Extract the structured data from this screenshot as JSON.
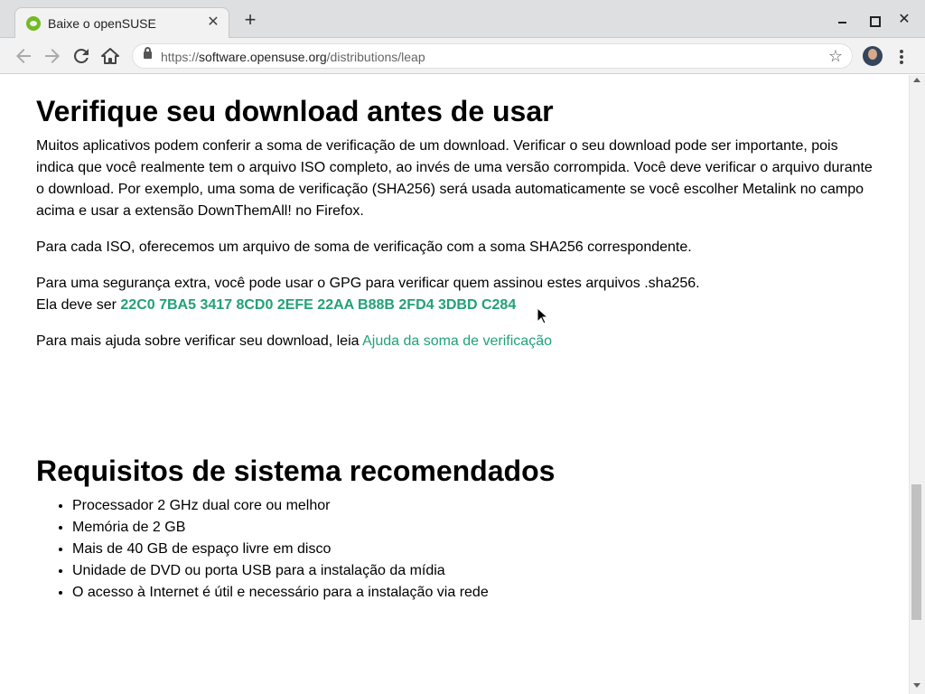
{
  "browser": {
    "tab_title": "Baixe o openSUSE",
    "tab_close": "✕",
    "new_tab": "+",
    "url_scheme": "https://",
    "url_host": "software.opensuse.org",
    "url_path": "/distributions/leap",
    "window_close": "✕"
  },
  "icons": {
    "back": "arrow-left-icon",
    "forward": "arrow-right-icon",
    "reload": "reload-icon",
    "home": "home-icon",
    "lock": "lock-icon",
    "star": "star-icon",
    "menu": "kebab-menu-icon"
  },
  "section_verify": {
    "heading": "Verifique seu download antes de usar",
    "para1": "Muitos aplicativos podem conferir a soma de verificação de um download. Verificar o seu download pode ser importante, pois indica que você realmente tem o arquivo ISO completo, ao invés de uma versão corrompida. Você deve verificar o arquivo durante o download. Por exemplo, uma soma de verificação (SHA256) será usada automaticamente se você escolher Metalink no campo acima e usar a extensão DownThemAll! no Firefox.",
    "para2": "Para cada ISO, oferecemos um arquivo de soma de verificação com a soma SHA256 correspondente.",
    "para3_line1": "Para uma segurança extra, você pode usar o GPG para verificar quem assinou estes arquivos .sha256.",
    "para3_line2_prefix": "Ela deve ser",
    "gpg_fingerprint": "22C0 7BA5 3417 8CD0 2EFE 22AA B88B 2FD4 3DBD C284",
    "para4_prefix": "Para mais ajuda sobre verificar seu download, leia",
    "help_link": "Ajuda da soma de verificação"
  },
  "section_requirements": {
    "heading": "Requisitos de sistema recomendados",
    "items": [
      "Processador 2 GHz dual core ou melhor",
      "Memória de 2 GB",
      "Mais de 40 GB de espaço livre em disco",
      "Unidade de DVD ou porta USB para a instalação da mídia",
      "O acesso à Internet é útil e necessário para a instalação via rede"
    ]
  },
  "colors": {
    "link": "#21a179",
    "tab_bar": "#dedfe1",
    "toolbar": "#f2f2f2"
  }
}
